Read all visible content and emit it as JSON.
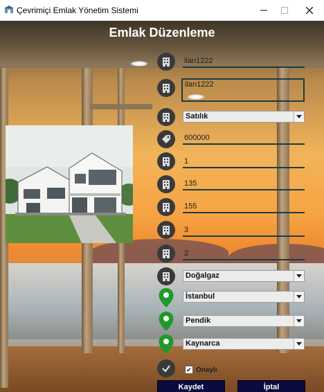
{
  "window": {
    "title": "Çevrimiçi Emlak Yönetim Sistemi",
    "min_glyph": "—",
    "max_glyph": "☐",
    "close_glyph": "✕"
  },
  "page": {
    "title": "Emlak Düzenleme"
  },
  "form": {
    "ilan_no": "ilan1222",
    "aciklama": "ilan1222",
    "durum": "Satılık",
    "fiyat": "600000",
    "field_4": "1",
    "field_5": "135",
    "field_6": "155",
    "field_7": "3",
    "field_8": "2",
    "isitma": "Doğalgaz",
    "il": "İstanbul",
    "ilce": "Pendik",
    "mahalle": "Kaynarca",
    "onayli_label": "Onaylı",
    "onayli_checked": true,
    "checkbox_glyph": "✔"
  },
  "buttons": {
    "save": "Kaydet",
    "cancel": "İptal"
  },
  "icons": {
    "building": "building-icon",
    "tag": "price-tag-icon",
    "pin": "location-pin-icon",
    "check": "checkmark-icon",
    "combo": "chevron-down-icon"
  },
  "colors": {
    "button_bg": "#0a0b3e",
    "field_underline": "#1a3c42",
    "pin_green": "#1c9a2a",
    "icon_bg": "#3a3a3a"
  }
}
